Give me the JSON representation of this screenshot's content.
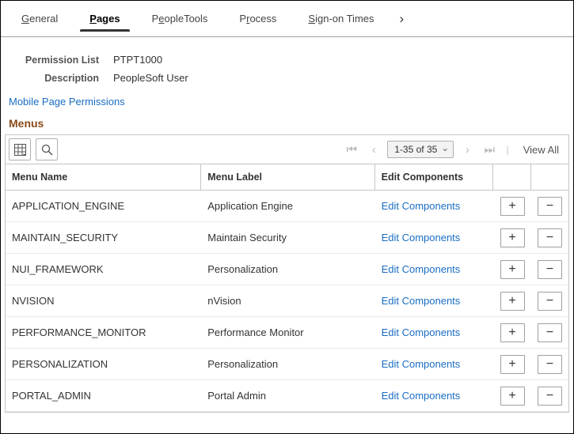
{
  "tabs": {
    "general": "General",
    "pages": "Pages",
    "peopletools": "PeopleTools",
    "process": "Process",
    "signon": "Sign-on Times"
  },
  "info": {
    "permission_list_label": "Permission List",
    "permission_list_value": "PTPT1000",
    "description_label": "Description",
    "description_value": "PeopleSoft User"
  },
  "mobile_link": "Mobile Page Permissions",
  "section_title": "Menus",
  "grid": {
    "range": "1-35 of 35",
    "view_all": "View All",
    "headers": {
      "menu_name": "Menu Name",
      "menu_label": "Menu Label",
      "edit_components": "Edit Components"
    },
    "edit_link_text": "Edit Components",
    "rows": [
      {
        "name": "APPLICATION_ENGINE",
        "label": "Application Engine"
      },
      {
        "name": "MAINTAIN_SECURITY",
        "label": "Maintain Security"
      },
      {
        "name": "NUI_FRAMEWORK",
        "label": "Personalization"
      },
      {
        "name": "NVISION",
        "label": "nVision"
      },
      {
        "name": "PERFORMANCE_MONITOR",
        "label": "Performance Monitor"
      },
      {
        "name": "PERSONALIZATION",
        "label": "Personalization"
      },
      {
        "name": "PORTAL_ADMIN",
        "label": "Portal Admin"
      }
    ]
  }
}
